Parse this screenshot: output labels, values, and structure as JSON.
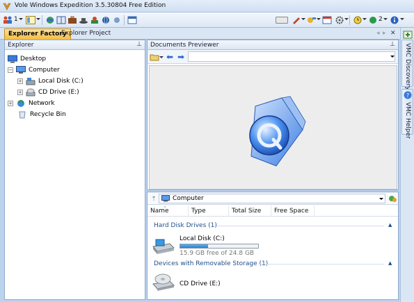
{
  "window": {
    "title": "Vole Windows Expedition  3.5.30804  Free Edition"
  },
  "toolbar": {
    "left_num": "1",
    "right_num": "2"
  },
  "tabs": [
    {
      "label": "Explorer Factory"
    },
    {
      "label": "Explorer Project"
    }
  ],
  "explorer": {
    "header": "Explorer",
    "tree": [
      {
        "label": "Desktop"
      },
      {
        "label": "Computer"
      },
      {
        "label": "Local Disk (C:)"
      },
      {
        "label": "CD Drive (E:)"
      },
      {
        "label": "Network"
      },
      {
        "label": "Recycle Bin"
      }
    ]
  },
  "preview": {
    "header": "Documents Previewer"
  },
  "listing": {
    "address": "Computer",
    "columns": [
      "Name",
      "Type",
      "Total Size",
      "Free Space"
    ],
    "groups": [
      {
        "title": "Hard Disk Drives (1)",
        "items": [
          {
            "name": "Local Disk (C:)",
            "detail": "15.9 GB free of 24.8 GB",
            "used_fraction": 0.36
          }
        ]
      },
      {
        "title": "Devices with Removable Storage (1)",
        "items": [
          {
            "name": "CD Drive (E:)"
          }
        ]
      }
    ]
  },
  "side_tabs": [
    {
      "label": "VMC Discovery"
    },
    {
      "label": "VMC Helper"
    }
  ],
  "colors": {
    "accent_tab": "#f2bb45",
    "frame": "#bcd3ee",
    "progress": "#2a7fd0"
  }
}
